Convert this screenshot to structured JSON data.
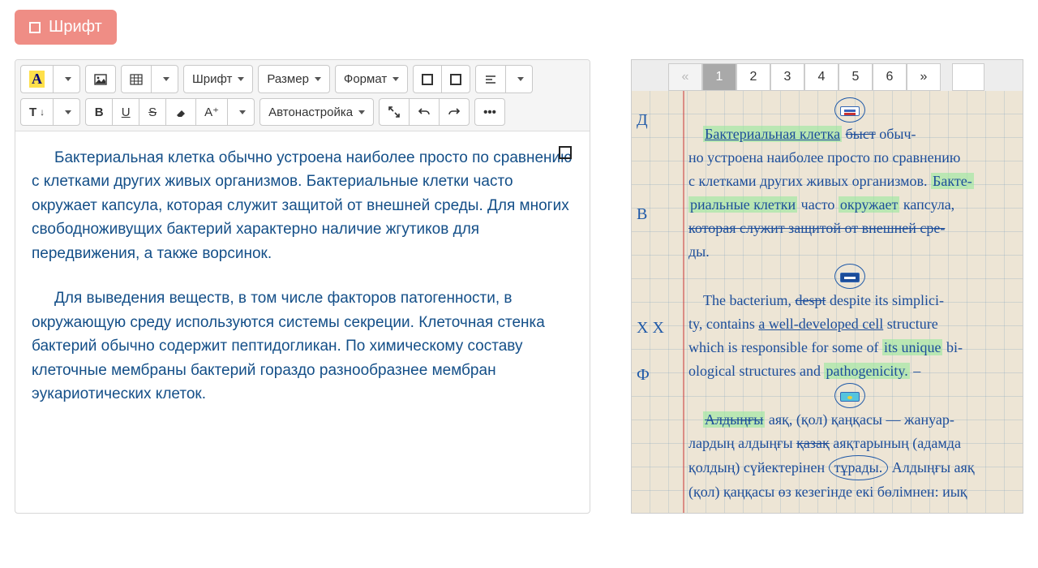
{
  "top_button": {
    "label": "Шрифт"
  },
  "toolbar": {
    "font_label": "Шрифт",
    "size_label": "Размер",
    "format_label": "Формат",
    "autoadjust_label": "Автонастройка",
    "a_letter": "A",
    "a_plus": "A⁺",
    "b": "B",
    "u": "U",
    "s": "S",
    "t": "T",
    "t_arrow": "¶",
    "more": "•••"
  },
  "editor": {
    "para1": "Бактериальная клетка обычно устроена наиболее просто по сравнению с клетками других живых организмов. Бактериальные клетки часто окружает капсула, которая служит защитой от внешней среды. Для многих свободноживущих бактерий характерно наличие жгутиков для передвижения, а также ворсинок.",
    "para2": "Для выведения веществ, в том числе факторов патогенности, в окружающую среду используются системы секреции. Клеточная стенка бактерий обычно содержит пептидогликан. По химическому составу клеточные мембраны бактерий гораздо разнообразнее мембран эукариотических клеток."
  },
  "pager": {
    "prev": "«",
    "next": "»",
    "pages": [
      "1",
      "2",
      "3",
      "4",
      "5",
      "6"
    ],
    "active_index": 0
  },
  "handwriting": {
    "margin_marks": {
      "m1": "Д",
      "m2": "В",
      "m3": "Х Х",
      "m4": "Ф"
    },
    "ru": {
      "l1a": "Бактериальная клетка",
      "l1b_strike": "быст",
      "l1c": "обыч-",
      "l2": "но устроена наиболее просто по сравнению",
      "l3a": "с клетками других живых организмов.",
      "l3b": "Бакте-",
      "l4a": "риальные клетки",
      "l4b": "часто",
      "l4c": "окружает",
      "l4d": "капсула,",
      "l5_strike": "которая служит защитой от внешней сре-",
      "l6": "ды."
    },
    "en": {
      "l1a": "The bacterium,",
      "l1b_strike": "despt",
      "l1c": "despite   its simplici-",
      "l2a": "ty, contains",
      "l2b_ul": "a well-developed cell",
      "l2c": "structure",
      "l3a": "which is responsible for some of",
      "l3b_hl": "its unique",
      "l3c": "bi-",
      "l4a": "ological structures and",
      "l4b_hl": "pathogenicity.",
      "l4c": "–"
    },
    "kz": {
      "l1a_strike": "Алдыңғы",
      "l1b": "аяқ, (қол) қаңқасы — жануар-",
      "l2a": "лардың алдыңғы",
      "l2b_strike": "қазақ",
      "l2c": "аяқтарының (адамда",
      "l3a": "қолдың)  сүйектерінен",
      "l3b_circ": "тұрады.",
      "l3c": "Алдыңғы аяқ",
      "l4": "(қол) қаңқасы өз кезегінде екі бөлімнен: иық"
    }
  }
}
